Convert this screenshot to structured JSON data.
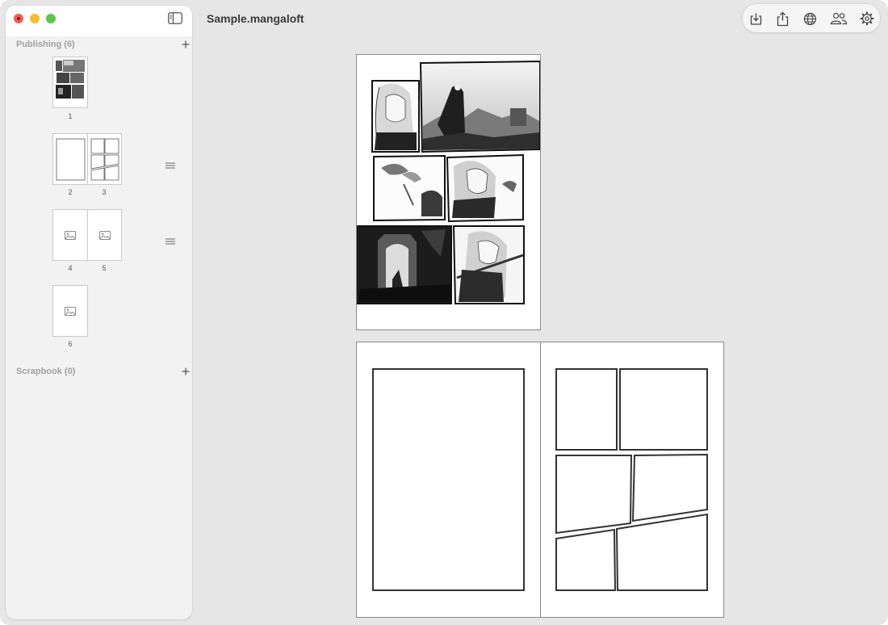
{
  "document": {
    "title": "Sample.mangaloft"
  },
  "sidebar": {
    "sections": [
      {
        "title": "Publishing (6)",
        "add_icon": "plus-icon"
      },
      {
        "title": "Scrapbook (0)",
        "add_icon": "plus-icon"
      }
    ],
    "pages": [
      {
        "label": "1",
        "kind": "illustrated"
      },
      {
        "label": "2",
        "kind": "single-panel"
      },
      {
        "label": "3",
        "kind": "panel-grid"
      },
      {
        "label": "4",
        "kind": "image-placeholder"
      },
      {
        "label": "5",
        "kind": "image-placeholder"
      },
      {
        "label": "6",
        "kind": "image-placeholder"
      }
    ],
    "toggle_icon": "sidebar-toggle-icon",
    "handle_icon": "drag-handle-icon"
  },
  "toolbar": {
    "buttons": [
      {
        "icon": "import-icon"
      },
      {
        "icon": "share-icon"
      },
      {
        "icon": "globe-icon"
      },
      {
        "icon": "people-icon"
      },
      {
        "icon": "gear-icon"
      }
    ]
  },
  "colors": {
    "window_bg": "#e6e6e6",
    "sidebar_bg": "#f2f2f2",
    "close": "#ec5f57",
    "minimize": "#f4bf2e",
    "zoom": "#5fc44e",
    "panel_stroke": "#333333"
  }
}
